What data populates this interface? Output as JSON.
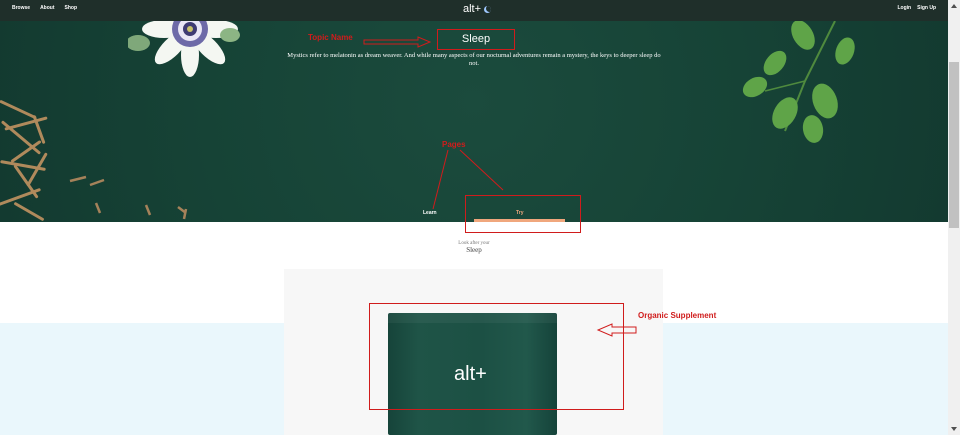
{
  "nav": {
    "left_items": [
      "Browse",
      "About",
      "Shop"
    ],
    "logo": "alt+",
    "right_items": [
      "Login",
      "Sign Up"
    ]
  },
  "hero": {
    "topic": "Sleep",
    "description": "Mystics refer to melatonin as dream weaver. And while many aspects of our nocturnal adventures remain a mystery, the keys to deeper sleep do not.",
    "tabs": [
      {
        "label": "Learn",
        "active": false
      },
      {
        "label": "Try",
        "active": true
      }
    ]
  },
  "section": {
    "eyebrow": "Look after your",
    "title": "Sleep"
  },
  "product": {
    "pouch_brand": "alt+"
  },
  "annotations": {
    "topic_name": "Topic Name",
    "pages": "Pages",
    "organic_supplement": "Organic Supplement"
  },
  "colors": {
    "nav_bg": "#1f2f2a",
    "hero_bg": "#174738",
    "tab_underline": "#f0a77d",
    "annotation_red": "#d01c1c",
    "band_bg": "#eaf7fc"
  }
}
